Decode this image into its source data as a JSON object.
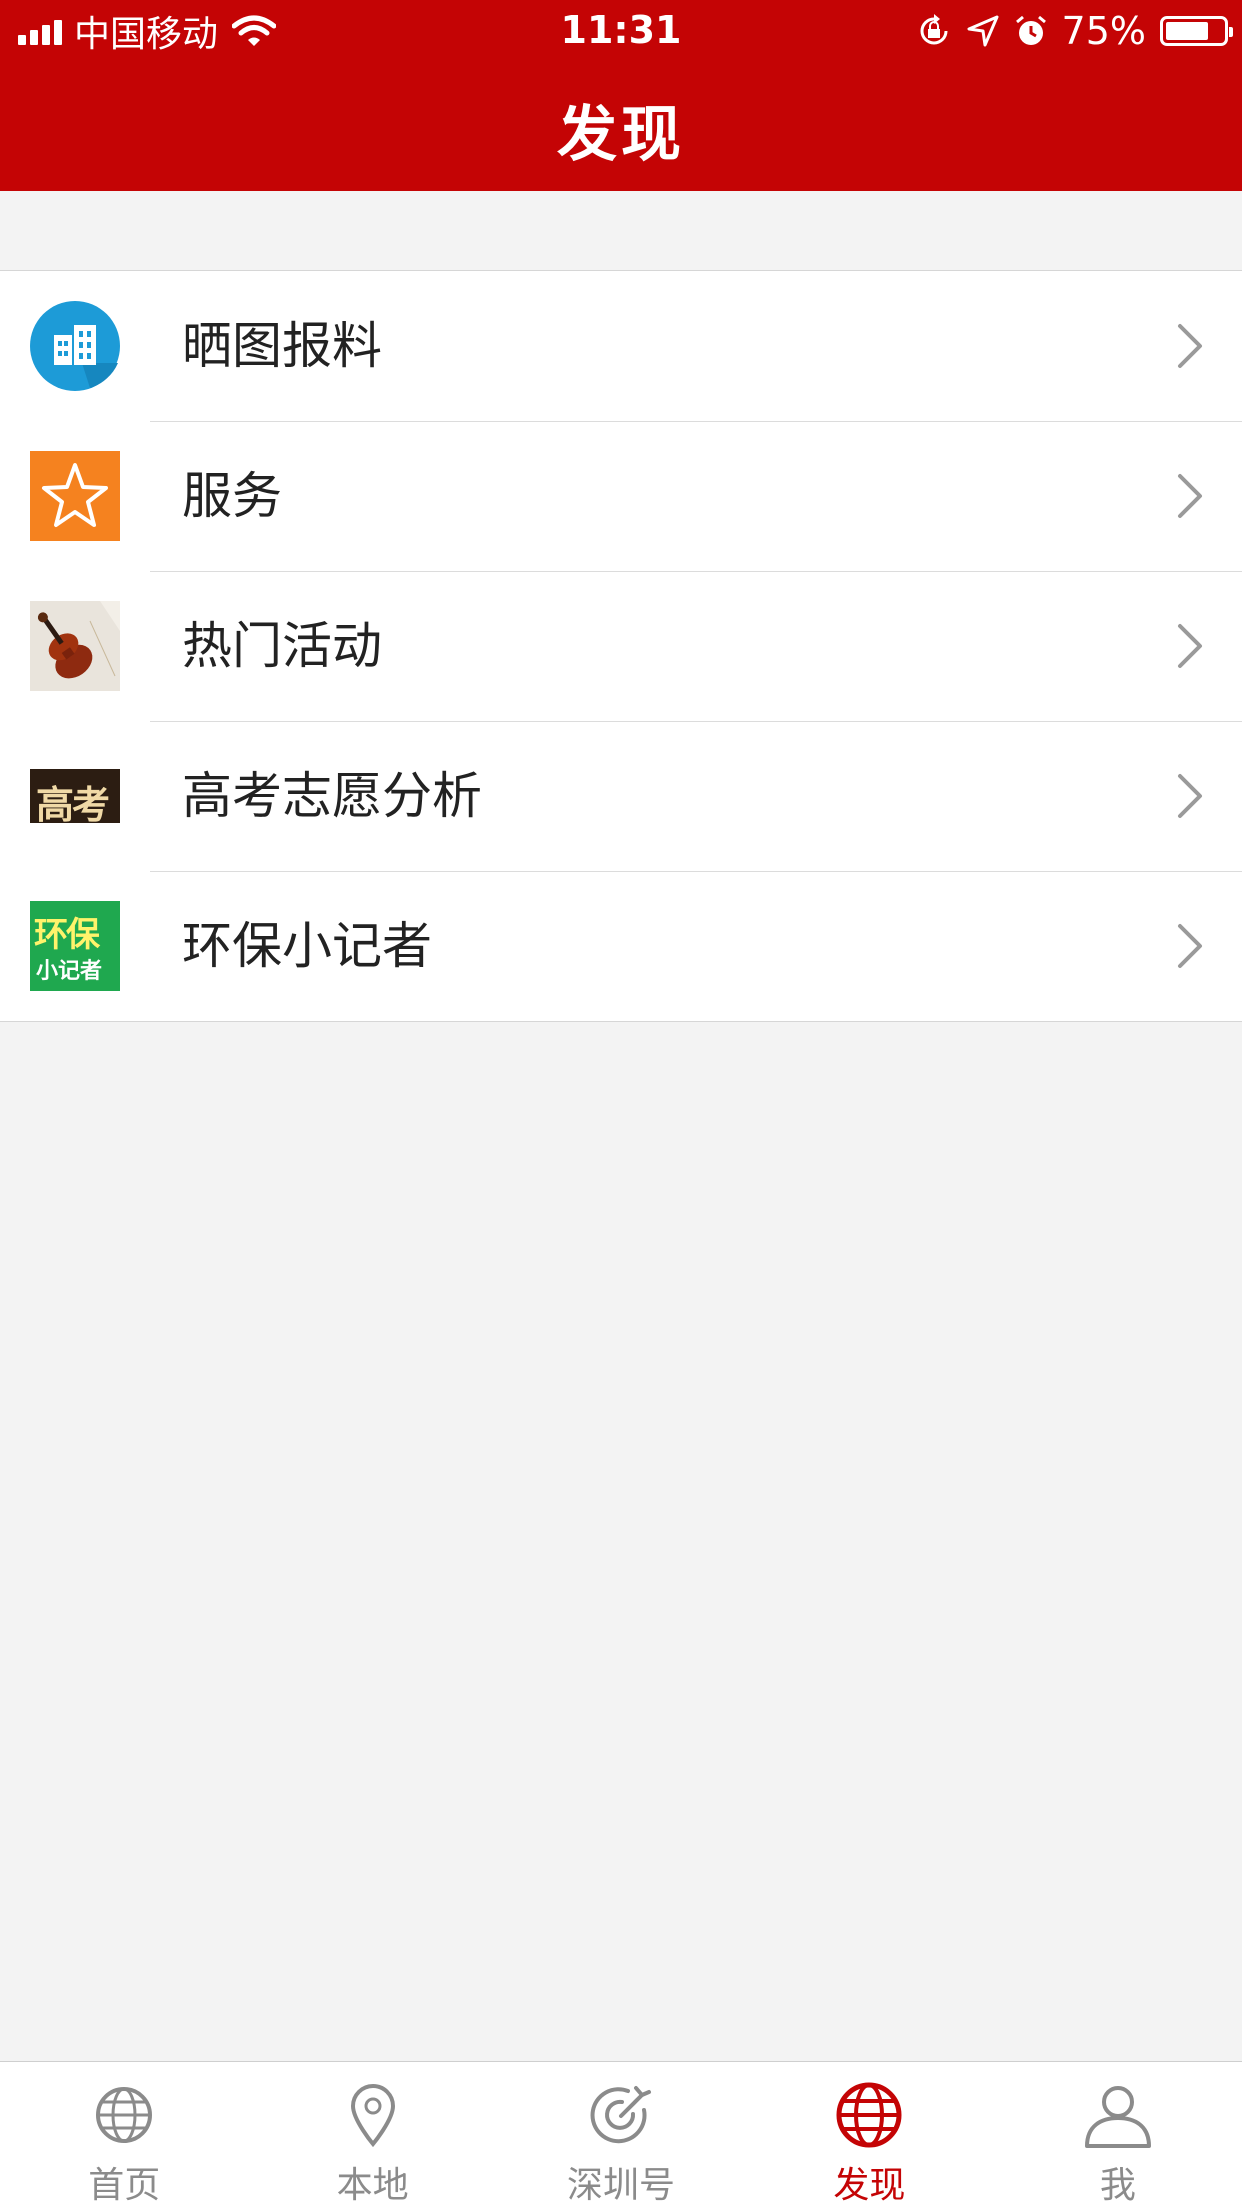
{
  "status_bar": {
    "carrier": "中国移动",
    "time": "11:31",
    "battery": "75%",
    "battery_level": 0.75
  },
  "header": {
    "title": "发现",
    "color": "#c40405"
  },
  "list": {
    "items": [
      {
        "label": "晒图报料",
        "icon": "buildings-icon"
      },
      {
        "label": "服务",
        "icon": "star-icon"
      },
      {
        "label": "热门活动",
        "icon": "violin-photo"
      },
      {
        "label": "高考志愿分析",
        "icon_text": "高考",
        "icon": "gaokao-logo"
      },
      {
        "label": "环保小记者",
        "icon_text_1": "环保",
        "icon_text_2": "小记者",
        "icon": "reporter-logo"
      }
    ]
  },
  "tabbar": {
    "tabs": [
      {
        "label": "首页",
        "icon": "globe-icon"
      },
      {
        "label": "本地",
        "icon": "location-pin-icon"
      },
      {
        "label": "深圳号",
        "icon": "target-icon"
      },
      {
        "label": "发现",
        "icon": "globe-icon",
        "active": true
      },
      {
        "label": "我",
        "icon": "person-icon"
      }
    ],
    "active_color": "#c40405",
    "inactive_color": "#8b8b8b"
  }
}
